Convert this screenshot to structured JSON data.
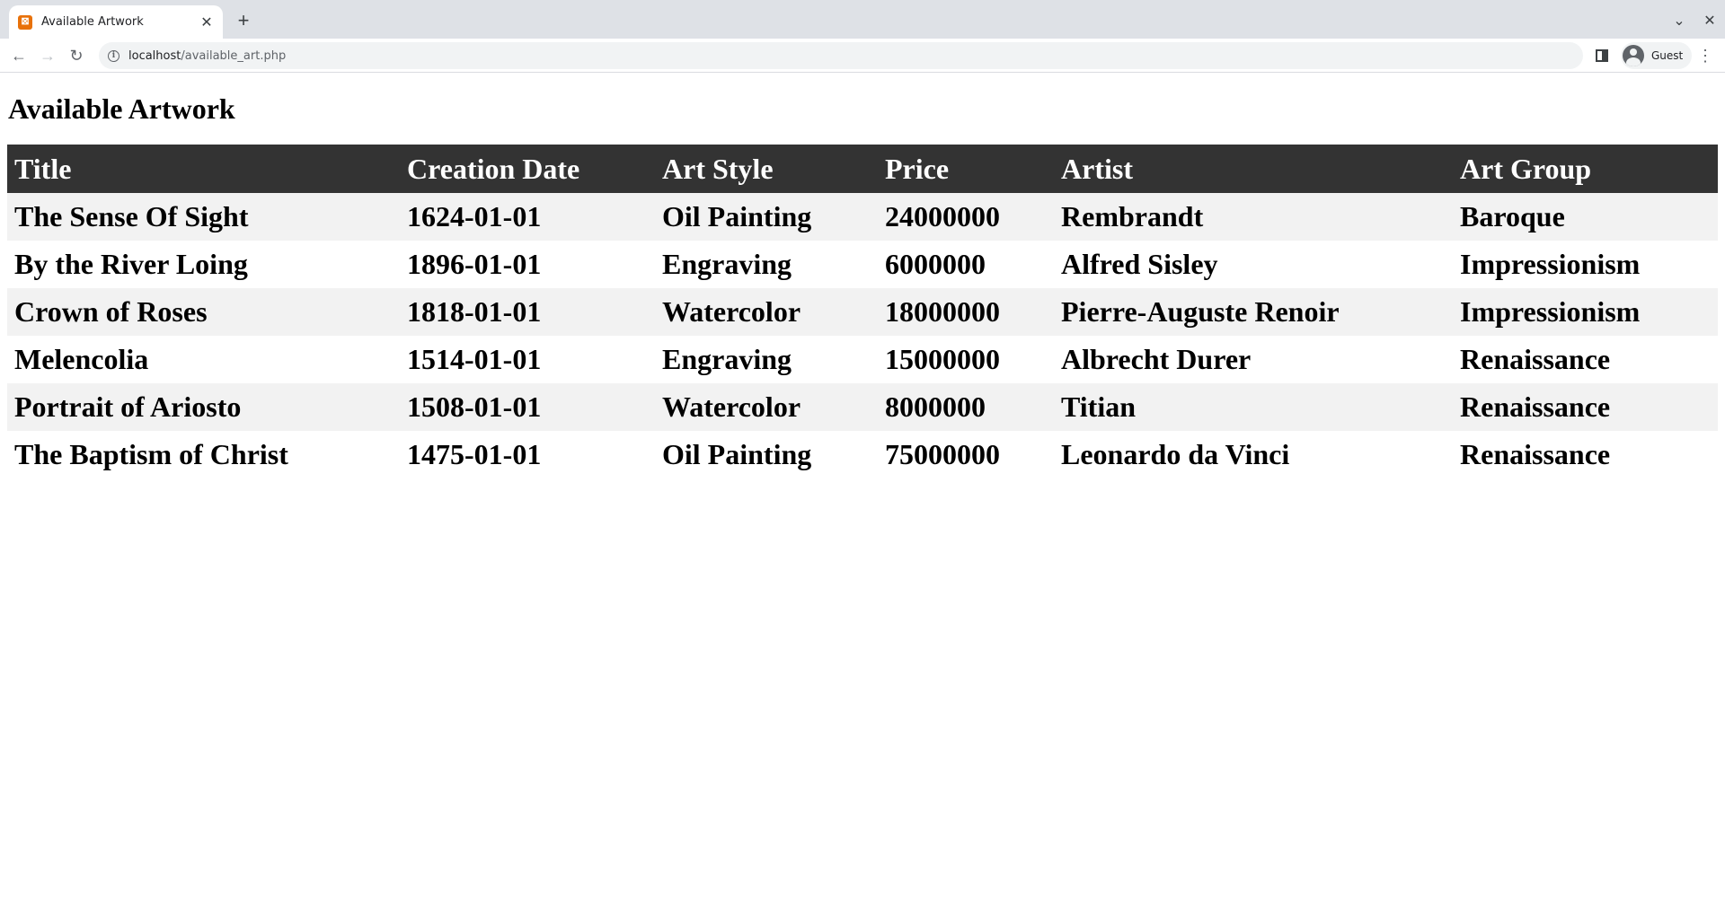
{
  "browser": {
    "tab_title": "Available Artwork",
    "favicon_glyph": "⊠",
    "url_host": "localhost",
    "url_path": "/available_art.php",
    "profile_label": "Guest"
  },
  "page": {
    "heading": "Available Artwork",
    "columns": [
      "Title",
      "Creation Date",
      "Art Style",
      "Price",
      "Artist",
      "Art Group"
    ],
    "rows": [
      [
        "The Sense Of Sight",
        "1624-01-01",
        "Oil Painting",
        "24000000",
        "Rembrandt",
        "Baroque"
      ],
      [
        "By the River Loing",
        "1896-01-01",
        "Engraving",
        "6000000",
        "Alfred Sisley",
        "Impressionism"
      ],
      [
        "Crown of Roses",
        "1818-01-01",
        "Watercolor",
        "18000000",
        "Pierre-Auguste Renoir",
        "Impressionism"
      ],
      [
        "Melencolia",
        "1514-01-01",
        "Engraving",
        "15000000",
        "Albrecht Durer",
        "Renaissance"
      ],
      [
        "Portrait of Ariosto",
        "1508-01-01",
        "Watercolor",
        "8000000",
        "Titian",
        "Renaissance"
      ],
      [
        "The Baptism of Christ",
        "1475-01-01",
        "Oil Painting",
        "75000000",
        "Leonardo da Vinci",
        "Renaissance"
      ]
    ]
  }
}
